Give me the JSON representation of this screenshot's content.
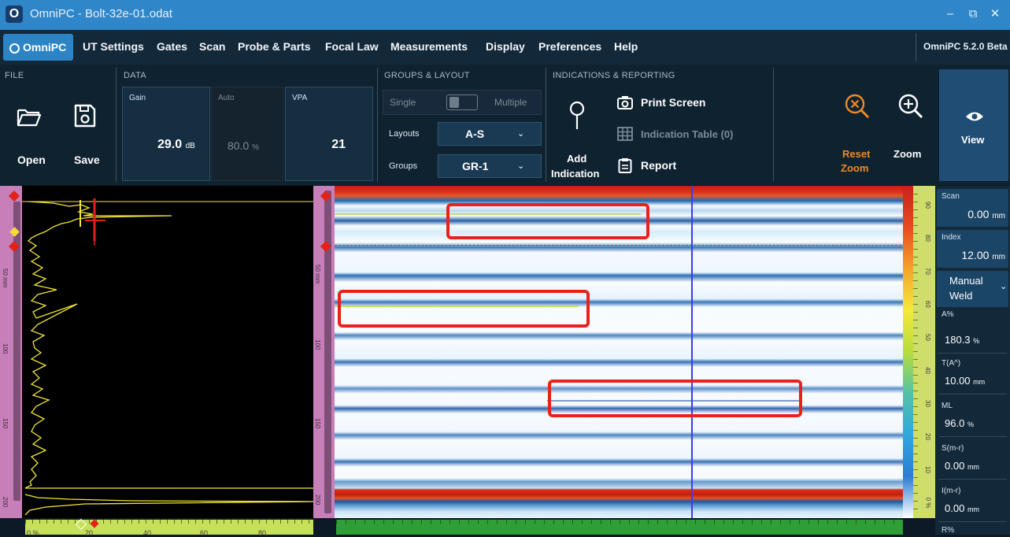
{
  "window": {
    "title": "OmniPC - Bolt-32e-01.odat",
    "minimize_glyph": "–",
    "restore_glyph": "⧉",
    "close_glyph": "✕"
  },
  "menu": {
    "home_tab": "OmniPC",
    "items": [
      "UT Settings",
      "Gates",
      "Scan",
      "Probe & Parts",
      "Focal Law",
      "Measurements",
      "Display",
      "Preferences",
      "Help"
    ],
    "version": "OmniPC 5.2.0 Beta"
  },
  "ribbon": {
    "file": {
      "title": "FILE",
      "open_label": "Open",
      "save_label": "Save"
    },
    "data": {
      "title": "DATA",
      "gain": {
        "label": "Gain",
        "value": "29.0",
        "unit": "dB"
      },
      "auto": {
        "label": "Auto",
        "value": "80.0",
        "unit": "%"
      },
      "vpa": {
        "label": "VPA",
        "value": "21"
      }
    },
    "groups_layout": {
      "title": "GROUPS & LAYOUT",
      "single_label": "Single",
      "multiple_label": "Multiple",
      "layouts_label": "Layouts",
      "layouts_value": "A-S",
      "groups_label": "Groups",
      "groups_value": "GR-1"
    },
    "indications": {
      "title": "INDICATIONS & REPORTING",
      "add_label_1": "Add",
      "add_label_2": "Indication",
      "print_screen": "Print Screen",
      "indication_table": "Indication Table (0)",
      "report": "Report"
    },
    "zoom": {
      "reset_label_1": "Reset",
      "reset_label_2": "Zoom",
      "zoom_label": "Zoom",
      "view_label": "View"
    }
  },
  "readings": {
    "scan": {
      "label": "Scan",
      "value": "0.00",
      "unit": "mm"
    },
    "index": {
      "label": "Index",
      "value": "12.00",
      "unit": "mm"
    },
    "mode": {
      "line1": "Manual",
      "line2": "Weld"
    },
    "a_pct": {
      "label": "A%",
      "value": "180.3",
      "unit": "%"
    },
    "t_a": {
      "label": "T(A^)",
      "value": "10.00",
      "unit": "mm"
    },
    "ml": {
      "label": "ML",
      "value": "96.0",
      "unit": "%"
    },
    "s_m_r": {
      "label": "S(m-r)",
      "value": "0.00",
      "unit": "mm"
    },
    "i_m_r": {
      "label": "I(m-r)",
      "value": "0.00",
      "unit": "mm"
    },
    "r_pct": {
      "label": "R%"
    }
  },
  "rulers": {
    "ascan_depth_ticks": [
      "50 mm",
      "100",
      "150",
      "200"
    ],
    "sscan_depth_ticks": [
      "50 mm",
      "100",
      "150",
      "200"
    ],
    "ascan_x_ticks": [
      "0 %",
      "20",
      "40",
      "60",
      "80"
    ],
    "color_scale_ticks": [
      "90",
      "80",
      "70",
      "60",
      "50",
      "40",
      "30",
      "20",
      "10",
      "0 %"
    ]
  },
  "colors": {
    "titlebar": "#2f86c8",
    "accent": "#2d84c5",
    "ascan_signal": "#f2e634",
    "cursor_line": "#3c3cf0",
    "highlight_box": "#e8221b",
    "reset_zoom": "#f08a25"
  }
}
